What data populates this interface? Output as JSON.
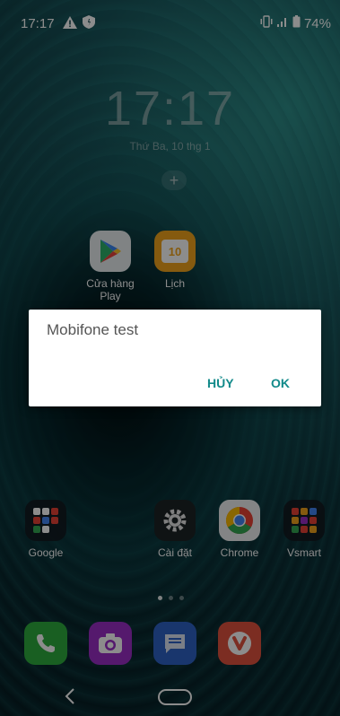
{
  "status_bar": {
    "time": "17:17",
    "battery": "74%",
    "left_icons": [
      "warning-icon",
      "shield-icon"
    ],
    "right_icons": [
      "vibrate-icon",
      "signal-icon",
      "battery-icon"
    ]
  },
  "lockclock": {
    "time": "17:17",
    "date": "Thứ Ba, 10 thg 1",
    "add_label": "+"
  },
  "home_apps": [
    {
      "label": "Cửa hàng\nPlay",
      "icon": "play-store-icon"
    },
    {
      "label": "Lịch",
      "icon": "calendar-icon",
      "badge": "10"
    }
  ],
  "row_apps": [
    {
      "label": "Google",
      "icon": "google-folder-icon"
    },
    {
      "label": "Cài đặt",
      "icon": "settings-icon"
    },
    {
      "label": "Chrome",
      "icon": "chrome-icon"
    },
    {
      "label": "Vsmart",
      "icon": "vsmart-folder-icon"
    }
  ],
  "dock": [
    {
      "icon": "phone-icon",
      "color": "#2fae3f"
    },
    {
      "icon": "camera-icon",
      "color": "#9b2fc7"
    },
    {
      "icon": "messages-icon",
      "color": "#2f63c7"
    },
    {
      "icon": "vivaldi-icon",
      "color": "#e2533f"
    }
  ],
  "dialog": {
    "title": "Mobifone test",
    "cancel_label": "HỦY",
    "ok_label": "OK"
  },
  "page_indicator": {
    "count": 3,
    "active": 1
  },
  "colors": {
    "accent": "#128a8a"
  }
}
